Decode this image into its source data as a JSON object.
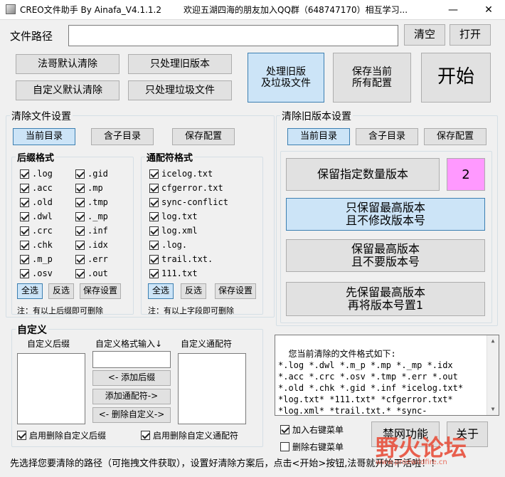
{
  "window": {
    "title": "CREO文件助手 By Ainafa_V4.1.1.2",
    "title_extra": "欢迎五湖四海的朋友加入QQ群（648747170）相互学习...",
    "minimize": "—",
    "maximize": "☐",
    "close": "✕"
  },
  "path": {
    "label": "文件路径",
    "value": "",
    "clear": "清空",
    "open": "打开"
  },
  "top_buttons": {
    "faye_default": "法哥默认清除",
    "old_only": "只处理旧版本",
    "custom_default": "自定义默认清除",
    "junk_only": "只处理垃圾文件",
    "old_and_junk": "处理旧版\n及垃圾文件",
    "save_config": "保存当前\n所有配置",
    "start": "开始"
  },
  "clear_settings": {
    "title": "清除文件设置",
    "current_dir": "当前目录",
    "sub_dir": "含子目录",
    "save_config": "保存配置",
    "suffix_title": "后缀格式",
    "suffix_col1": [
      ".log",
      ".acc",
      ".old",
      ".dwl",
      ".crc",
      ".chk",
      ".m_p",
      ".osv"
    ],
    "suffix_col2": [
      ".gid",
      ".mp",
      ".tmp",
      "._mp",
      ".inf",
      ".idx",
      ".err",
      ".out"
    ],
    "suffix_select_all": "全选",
    "suffix_invert": "反选",
    "suffix_save": "保存设置",
    "suffix_note": "注：有以上后缀即可删除",
    "wild_title": "通配符格式",
    "wild_items": [
      "icelog.txt",
      "cfgerror.txt",
      "sync-conflict",
      "log.txt",
      "log.xml",
      ".log.",
      "trail.txt.",
      "111.txt"
    ],
    "wild_select_all": "全选",
    "wild_invert": "反选",
    "wild_save": "保存设置",
    "wild_note": "注：有以上字段即可删除"
  },
  "custom": {
    "title": "自定义",
    "suffix_label": "自定义后缀",
    "input_label": "自定义格式输入↓",
    "wild_label": "自定义通配符",
    "input_value": "",
    "add_suffix": "<- 添加后缀",
    "add_wild": "添加通配符->",
    "delete_custom": "<- 删除自定义->",
    "enable_suffix": "启用删除自定义后缀",
    "enable_wild": "启用删除自定义通配符"
  },
  "old_version": {
    "title": "清除旧版本设置",
    "current_dir": "当前目录",
    "sub_dir": "含子目录",
    "save_config": "保存配置",
    "keep_count": "保留指定数量版本",
    "count_value": "2",
    "keep_highest_nochange": "只保留最高版本\n且不修改版本号",
    "keep_highest_noversion": "保留最高版本\n且不要版本号",
    "keep_highest_reset": "先保留最高版本\n再将版本号置1",
    "count_color": "#ff99ff"
  },
  "output": {
    "text": "您当前清除的文件格式如下:\n*.log *.dwl *.m_p *.mp *._mp *.idx\n*.acc *.crc *.osv *.tmp *.err *.out\n*.old *.chk *.gid *.inf *icelog.txt*\n*log.txt* *111.txt* *cfgerror.txt*\n*log.xml* *trail.txt.* *sync-\nconflict* *.log.*"
  },
  "context_menu": {
    "add": "加入右键菜单",
    "remove": "删除右键菜单"
  },
  "bottom_buttons": {
    "ban_network": "禁网功能",
    "about": "关于"
  },
  "status": "先选择您要清除的路径（可拖拽文件获取），设置好清除方案后，点击<开始>按钮,法哥就开始干活啦！！",
  "watermark": {
    "main": "野火论坛",
    "url": "www.proewildfire.cn"
  }
}
